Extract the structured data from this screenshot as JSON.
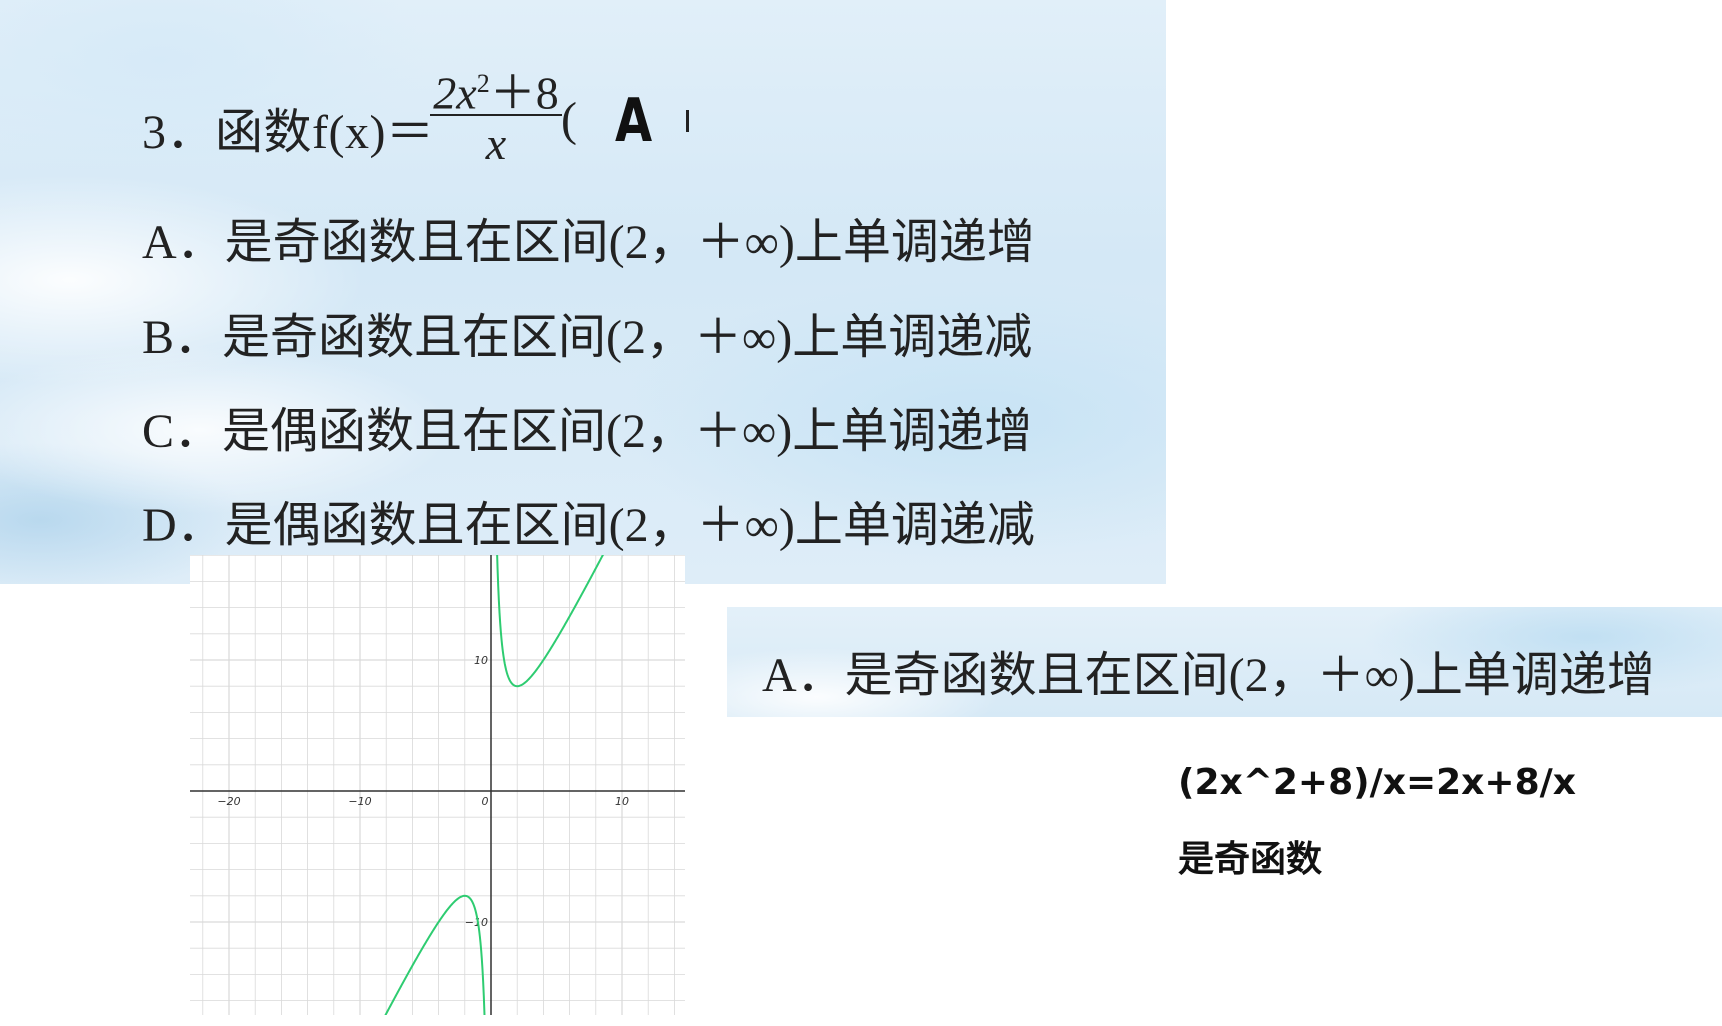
{
  "question": {
    "number": "3．",
    "stem_prefix": "函数f(x)＝",
    "fraction_numerator": "2x",
    "fraction_exponent": "2",
    "fraction_numerator_rest": "＋8",
    "fraction_denominator": "x",
    "open_paren": "(",
    "answer": "A",
    "options": [
      {
        "text": "A．是奇函数且在区间(2，＋∞)上单调递增"
      },
      {
        "text": "B．是奇函数且在区间(2，＋∞)上单调递减"
      },
      {
        "text": "C．是偶函数且在区间(2，＋∞)上单调递增"
      },
      {
        "text": "D．是偶函数且在区间(2，＋∞)上单调递减"
      }
    ]
  },
  "graph": {
    "x_ticks": [
      "−20",
      "−10",
      "0",
      "10"
    ],
    "y_ticks": [
      "10",
      "−10"
    ],
    "curve_color": "#2ecc71",
    "grid_color": "#d9d9d9",
    "axis_color": "#333333"
  },
  "answer_banner": {
    "text": "A．是奇函数且在区间(2，＋∞)上单调递增"
  },
  "notes": {
    "line1": "(2x^2+8)/x=2x+8/x",
    "line2": "是奇函数"
  }
}
